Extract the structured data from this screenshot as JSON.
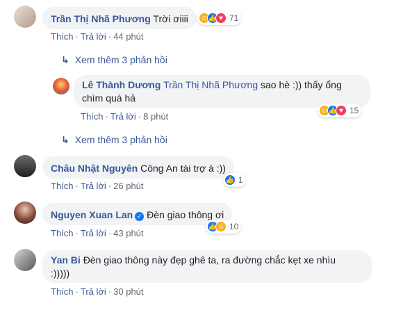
{
  "labels": {
    "like": "Thích",
    "reply": "Trả lời",
    "dot": "·"
  },
  "comments": [
    {
      "author": "Trần Thị Nhã Phương",
      "text": "Trời ơiiii",
      "time": "44 phút",
      "reactions": {
        "icons": [
          "haha-icon",
          "like-icon",
          "love-icon"
        ],
        "count": "71"
      }
    },
    {
      "author": "Lê Thành Dương",
      "mention": "Trần Thị Nhã Phương",
      "text_line1": "sao hè :)) thấy ổng",
      "text_line2": "chìm quá hả",
      "time": "8 phút",
      "reactions": {
        "icons": [
          "haha-icon",
          "like-icon",
          "love-icon"
        ],
        "count": "15"
      }
    },
    {
      "author": "Châu Nhật Nguyên",
      "text": "Công An tài trợ à :))",
      "time": "26 phút",
      "reactions": {
        "icons": [
          "like-icon"
        ],
        "count": "1"
      }
    },
    {
      "author": "Nguyen Xuan Lan",
      "text": "Đèn giao thông ơi",
      "time": "43 phút",
      "reactions": {
        "icons": [
          "like-icon",
          "haha-icon"
        ],
        "count": "10"
      }
    },
    {
      "author": "Yan Bi",
      "text_line1": "Đèn giao thông này đẹp ghê ta, ra đường chắc kẹt xe nhìu",
      "text_line2": ":)))))",
      "time": "30 phút"
    }
  ],
  "view_more": [
    "Xem thêm 3 phản hồi",
    "Xem thêm 3 phản hồi"
  ],
  "colors": {
    "link": "#385898",
    "bubble": "#f2f3f5",
    "meta": "#606770",
    "like": "#1877f2",
    "haha": "#f7b125",
    "love": "#f33e58"
  }
}
